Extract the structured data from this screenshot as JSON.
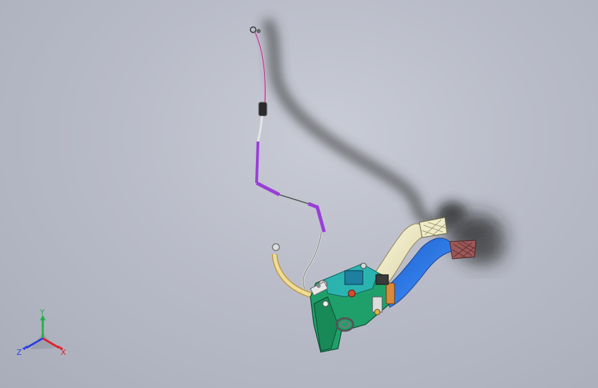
{
  "viewport": {
    "model": "pedal-box-assembly",
    "colors": {
      "background_top": "#c9ccd6",
      "background_bottom": "#a9adba",
      "bracket": "#1fa06a",
      "bracket_teal": "#2bb3b0",
      "brake_pedal_arm": "#f1ecc6",
      "clutch_pedal_arm": "#2b7be8",
      "pedal_pad_light": "#efeac8",
      "pedal_pad_red": "#9a5858",
      "cable_pink": "#e79ad0",
      "cable_purple": "#9a3ed8",
      "reservoir_hose": "#e8d38a",
      "shadow": "#1e1e1e"
    }
  },
  "triad": {
    "x_label": "X",
    "y_label": "Y",
    "z_label": "Z",
    "x_color": "#e0202a",
    "y_color": "#22b04a",
    "z_color": "#2b3ee0"
  }
}
